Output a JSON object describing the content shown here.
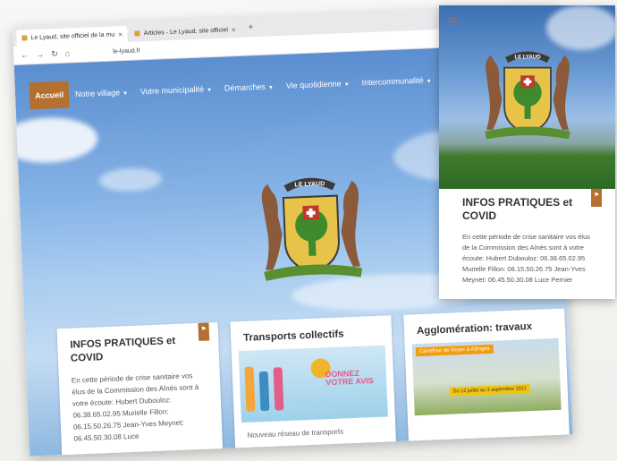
{
  "browser": {
    "tabs": [
      {
        "label": "Le Lyaud, site officiel de la mu"
      },
      {
        "label": "Articles - Le Lyaud, site officiel"
      }
    ],
    "url": "le-lyaud.fr"
  },
  "nav": {
    "home": "Accueil",
    "items": [
      {
        "label": "Notre village"
      },
      {
        "label": "Votre municipalité"
      },
      {
        "label": "Démarches"
      },
      {
        "label": "Vie quotidienne"
      },
      {
        "label": "Intercommunalité"
      }
    ]
  },
  "crest": {
    "banner": "LE LYAUD"
  },
  "cards": [
    {
      "title": "INFOS PRATIQUES et COVID",
      "text": "En cette période de crise sanitaire vos élus de la Commission des Aînés sont à votre écoute: Hubert Dubouloz: 06.38.65.02.95 Murielle Fillon: 06.15.50.26.75 Jean-Yves Meynet: 06.45.50.30.08 Luce"
    },
    {
      "title": "Transports collectifs",
      "poster": "DONNEZ VOTRE AVIS",
      "text": "Nouveau réseau de transports"
    },
    {
      "title": "Agglomération: travaux",
      "poster_header": "Carrefour de Noyer à Allinges",
      "poster_dates": "Du 12 juillet au 3 septembre 2021"
    }
  ],
  "inset": {
    "title": "INFOS PRATIQUES et COVID",
    "text": "En cette période de crise sanitaire vos élus de la Commission des Aînés sont à votre écoute: Hubert Dubouloz: 06.38.65.02.95 Murielle Fillon: 06.15.50.26.75 Jean-Yves Meynet: 06.45.50.30.08 Luce Pernier"
  },
  "colors": {
    "accent": "#b4702f",
    "sky": "#6f9fd6",
    "crest_gold": "#e7c34a",
    "crest_green": "#3f8a2d"
  }
}
